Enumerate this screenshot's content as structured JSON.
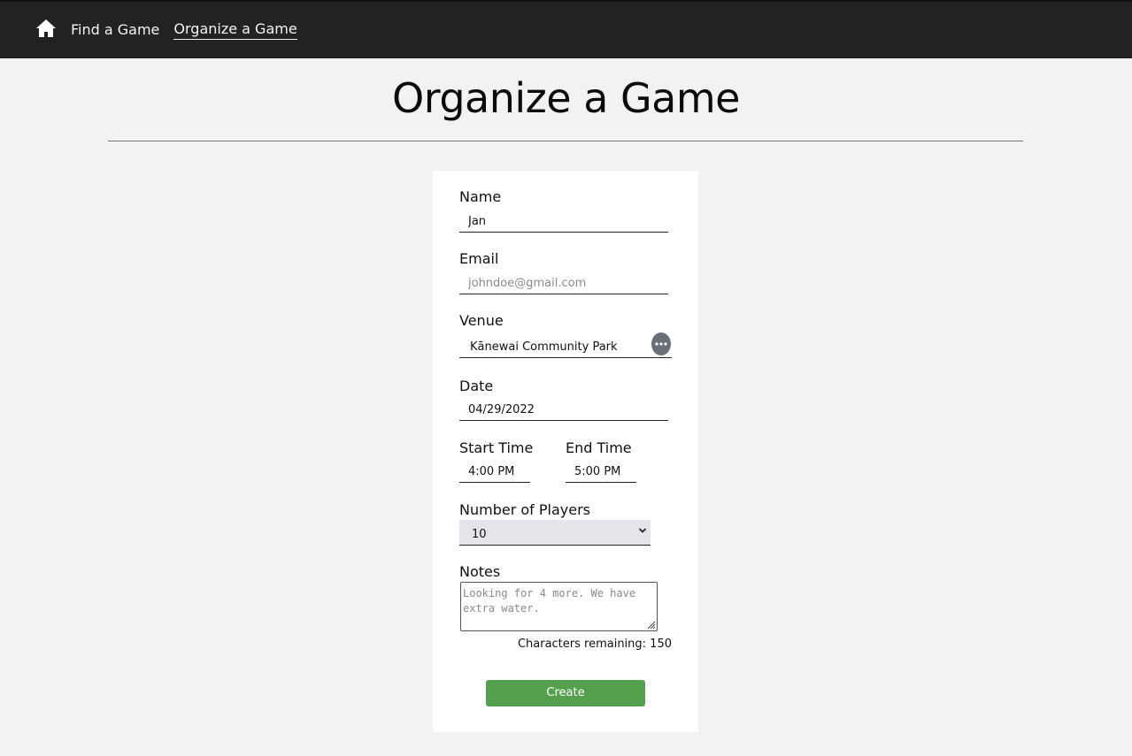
{
  "nav": {
    "home_icon": "home-icon",
    "links": [
      {
        "label": "Find a Game",
        "active": false
      },
      {
        "label": "Organize a Game",
        "active": true
      }
    ]
  },
  "page": {
    "title": "Organize a Game"
  },
  "form": {
    "name": {
      "label": "Name",
      "value": "Jan"
    },
    "email": {
      "label": "Email",
      "placeholder": "johndoe@gmail.com",
      "value": ""
    },
    "venue": {
      "label": "Venue",
      "value": "Kānewai Community Park",
      "more_icon": "ellipsis-icon"
    },
    "date": {
      "label": "Date",
      "value": "04/29/2022"
    },
    "start_time": {
      "label": "Start Time",
      "value": "4:00 PM"
    },
    "end_time": {
      "label": "End Time",
      "value": "5:00 PM"
    },
    "players": {
      "label": "Number of Players",
      "selected": "10",
      "icon": "chevron-down-icon"
    },
    "notes": {
      "label": "Notes",
      "placeholder": "Looking for 4 more. We have extra water."
    },
    "chars_remaining": "Characters remaining: 150",
    "submit_label": "Create"
  },
  "colors": {
    "navbar": "#222222",
    "background": "#f2f2f2",
    "card": "#ffffff",
    "submit": "#55a04c",
    "select_bg": "#e4e4ea"
  }
}
